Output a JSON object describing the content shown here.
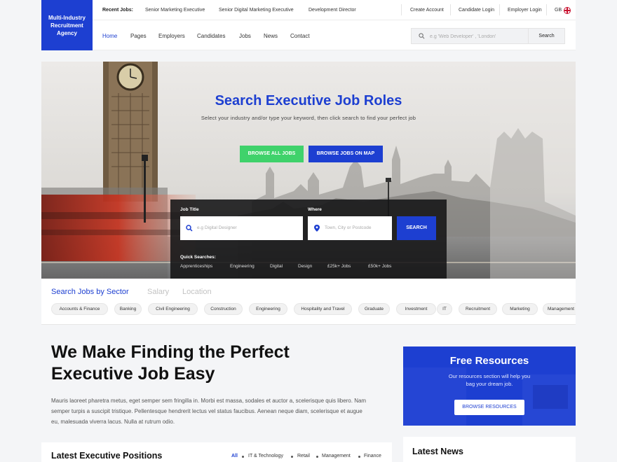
{
  "brand": {
    "name": "Multi-Industry Recruitment Agency",
    "color": "#1d3fd1"
  },
  "topbar": {
    "recent_label": "Recent Jobs:",
    "recent_jobs": [
      "Senior Marketing Executive",
      "Senior Digital Marketing Executive",
      "Development Director"
    ],
    "account_links": [
      "Create Account",
      "Candidate Login",
      "Employer Login"
    ],
    "language": "GB"
  },
  "nav": {
    "items": [
      "Home",
      "Pages",
      "Employers",
      "Candidates",
      "Jobs",
      "News",
      "Contact"
    ],
    "active": "Home",
    "search_placeholder": "e.g 'Web Developer' , 'London'",
    "search_button": "Search"
  },
  "hero": {
    "title": "Search Executive Job Roles",
    "subtitle": "Select your industry and/or type your keyword, then click search to find your perfect job",
    "btn_all_jobs": "BROWSE ALL JOBS",
    "btn_map": "BROWSE JOBS ON MAP",
    "green": "#3fd26b",
    "search": {
      "job_title_label": "Job Title",
      "job_title_placeholder": "e.g Digital Designer",
      "where_label": "Where",
      "where_placeholder": "Town, City or Postcode",
      "button": "SEARCH",
      "quick_label": "Quick Searches:",
      "quick": [
        "Apprenticeships",
        "Engineering",
        "Digital",
        "Design",
        "£25k+ Jobs",
        "£50k+ Jobs"
      ]
    }
  },
  "sector": {
    "tabs": [
      "Search Jobs by Sector",
      "Salary",
      "Location"
    ],
    "active_tab": "Search Jobs by Sector",
    "pills": [
      "Accounts & Finance",
      "Banking",
      "Civil Engineering",
      "Construction",
      "Engineering",
      "Hospitality and Travel",
      "Graduate",
      "Investment",
      "IT",
      "Recruitment",
      "Marketing",
      "Management"
    ]
  },
  "intro": {
    "title_line1": "We Make Finding the Perfect",
    "title_line2": "Executive Job Easy",
    "body": "Mauris laoreet pharetra metus, eget semper sem fringilla in. Morbi est massa, sodales et auctor a, scelerisque quis libero. Nam semper turpis a suscipit tristique. Pellentesque hendrerit lectus vel status faucibus. Aenean neque diam, scelerisque et augue eu, malesuada viverra lacus. Nulla at rutrum odio."
  },
  "resources": {
    "title": "Free Resources",
    "text": "Our resources section will help you bag your dream job.",
    "button": "BROWSE RESOURCES"
  },
  "positions": {
    "title": "Latest Executive Positions",
    "filters": [
      "All",
      "IT & Technology",
      "Retail",
      "Management",
      "Finance"
    ],
    "active_filter": "All"
  },
  "news": {
    "title": "Latest News"
  }
}
